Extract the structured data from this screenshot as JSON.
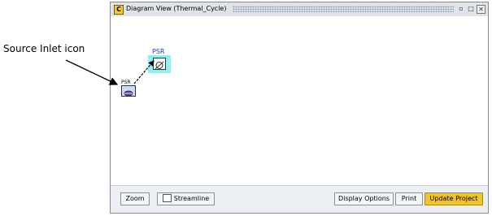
{
  "annotation": {
    "label": "Source Inlet icon"
  },
  "window": {
    "title": "Diagram View  (Thermal_Cycle)",
    "controls": {
      "restore": "▫",
      "maximize": "□",
      "close": "✕"
    }
  },
  "nodes": {
    "source_inlet": {
      "label": "PSR"
    },
    "psr": {
      "label": "PSR"
    }
  },
  "toolbar": {
    "zoom_label": "Zoom",
    "streamline_label": "Streamline",
    "display_options_label": "Display Options",
    "print_label": "Print",
    "update_project_label": "Update Project"
  },
  "colors": {
    "update_button": "#f1c232",
    "selected_node_highlight": "#8ff0f0",
    "node_label": "#2a3aa8"
  }
}
